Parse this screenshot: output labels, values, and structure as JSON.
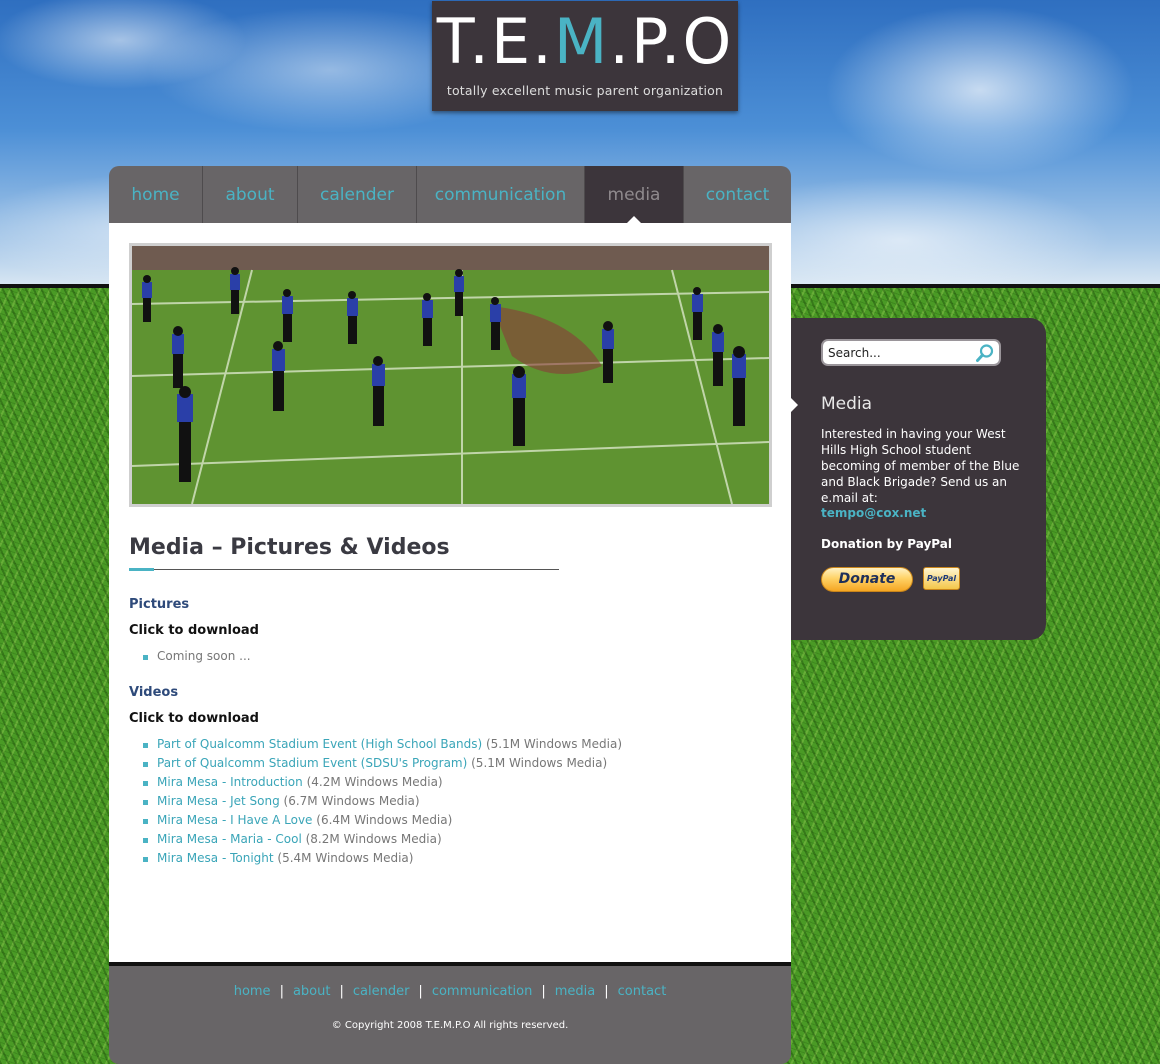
{
  "logo": {
    "pre": "T.E.",
    "highlight": "M",
    "post": ".P.O",
    "tagline": "totally excellent music parent organization"
  },
  "nav": {
    "items": [
      {
        "label": "home",
        "active": false
      },
      {
        "label": "about",
        "active": false
      },
      {
        "label": "calender",
        "active": false
      },
      {
        "label": "communication",
        "active": false
      },
      {
        "label": "media",
        "active": true
      },
      {
        "label": "contact",
        "active": false
      }
    ]
  },
  "main": {
    "title": "Media – Pictures & Videos",
    "pictures": {
      "heading": "Pictures",
      "subheading": "Click to download",
      "items": [
        "Coming soon ..."
      ]
    },
    "videos": {
      "heading": "Videos",
      "subheading": "Click to download",
      "items": [
        {
          "link": "Part of Qualcomm Stadium Event (High School Bands)",
          "info": " (5.1M Windows Media)"
        },
        {
          "link": "Part of Qualcomm Stadium Event (SDSU's Program)",
          "info": " (5.1M Windows Media)"
        },
        {
          "link": "Mira Mesa - Introduction",
          "info": " (4.2M Windows Media)"
        },
        {
          "link": "Mira Mesa - Jet Song",
          "info": " (6.7M Windows Media)"
        },
        {
          "link": "Mira Mesa - I Have A Love",
          "info": " (6.4M Windows Media)"
        },
        {
          "link": "Mira Mesa - Maria - Cool",
          "info": " (8.2M Windows Media)"
        },
        {
          "link": "Mira Mesa - Tonight",
          "info": " (5.4M Windows Media)"
        }
      ]
    }
  },
  "sidebar": {
    "search_placeholder": "Search...",
    "heading": "Media",
    "text": "Interested in having your West Hills High School student becoming of member of the Blue and Black Brigade? Send us an e.mail at:",
    "email": "tempo@cox.net",
    "donation_heading": "Donation by PayPal",
    "donate_label": "Donate",
    "paypal_label": "PayPal"
  },
  "footer": {
    "links": [
      "home",
      "about",
      "calender",
      "communication",
      "media",
      "contact"
    ],
    "copyright": "© Copyright 2008 T.E.M.P.O All rights reserved."
  },
  "colors": {
    "accent": "#4ab3c4",
    "dark_panel": "#3c353b",
    "nav_bg": "#686567",
    "heading_blue": "#2e4a7a"
  }
}
